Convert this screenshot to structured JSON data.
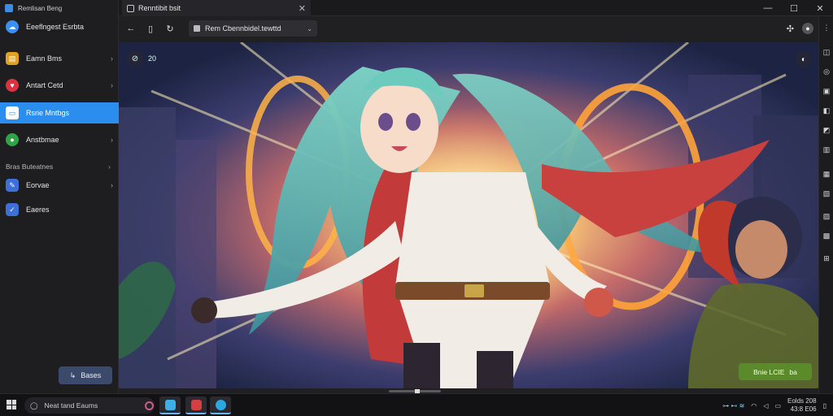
{
  "browser": {
    "tab_title": "Renntibit bsit",
    "tab_close": "✕",
    "window_controls": [
      "—",
      "☐",
      "✕"
    ],
    "nav": {
      "back": "←",
      "address_text": "Rem  Cbennbidel.tewttd"
    },
    "toolbar_icons": [
      "puzzle-icon",
      "profile-icon"
    ]
  },
  "sidebar": {
    "app_title": "Remlisan Beng",
    "items": [
      {
        "label": "Eeeflngest Esrbta",
        "icon": "blue-cloud-icon",
        "color": "#3b8ff0",
        "chevron": ""
      },
      {
        "label": "Eamn Bms",
        "icon": "yellow-box-icon",
        "color": "#e2a11e",
        "chevron": "›"
      },
      {
        "label": "Antart Cetd",
        "icon": "red-heart-icon",
        "color": "#d8333f",
        "chevron": "›"
      },
      {
        "label": "Rsrie Mntbgs",
        "icon": "window-icon",
        "color": "#ffffff",
        "chevron": ""
      },
      {
        "label": "Anstbmae",
        "icon": "green-circle-icon",
        "color": "#2fa447",
        "chevron": "›"
      },
      {
        "label": "Eorvae",
        "icon": "blue-pen-icon",
        "color": "#3c6fd8",
        "chevron": "›"
      },
      {
        "label": "Eaeres",
        "icon": "blue-check-icon",
        "color": "#3c6fd8",
        "chevron": ""
      }
    ],
    "section_label": "Bras Buteatnes",
    "section_chevron": "›",
    "bottom_button": "Bases",
    "bottom_button_icon": "↳"
  },
  "image_overlay": {
    "badge_text": "20",
    "badge_icon": "⊘",
    "corner_icon": "◐",
    "pill_text": "Bnie LCIE",
    "pill_suffix": "ba"
  },
  "taskbar": {
    "search_text": "Neat tand Eaums",
    "search_icon": "◯",
    "tray_text": "⊶ ⊷ ≋",
    "time_line1": "Eolds 208",
    "time_line2": "43:8 E06"
  },
  "colors": {
    "accent": "#2b8ded",
    "pill_green": "#5b8a2b",
    "sidebar_bg": "#1e1e21"
  }
}
